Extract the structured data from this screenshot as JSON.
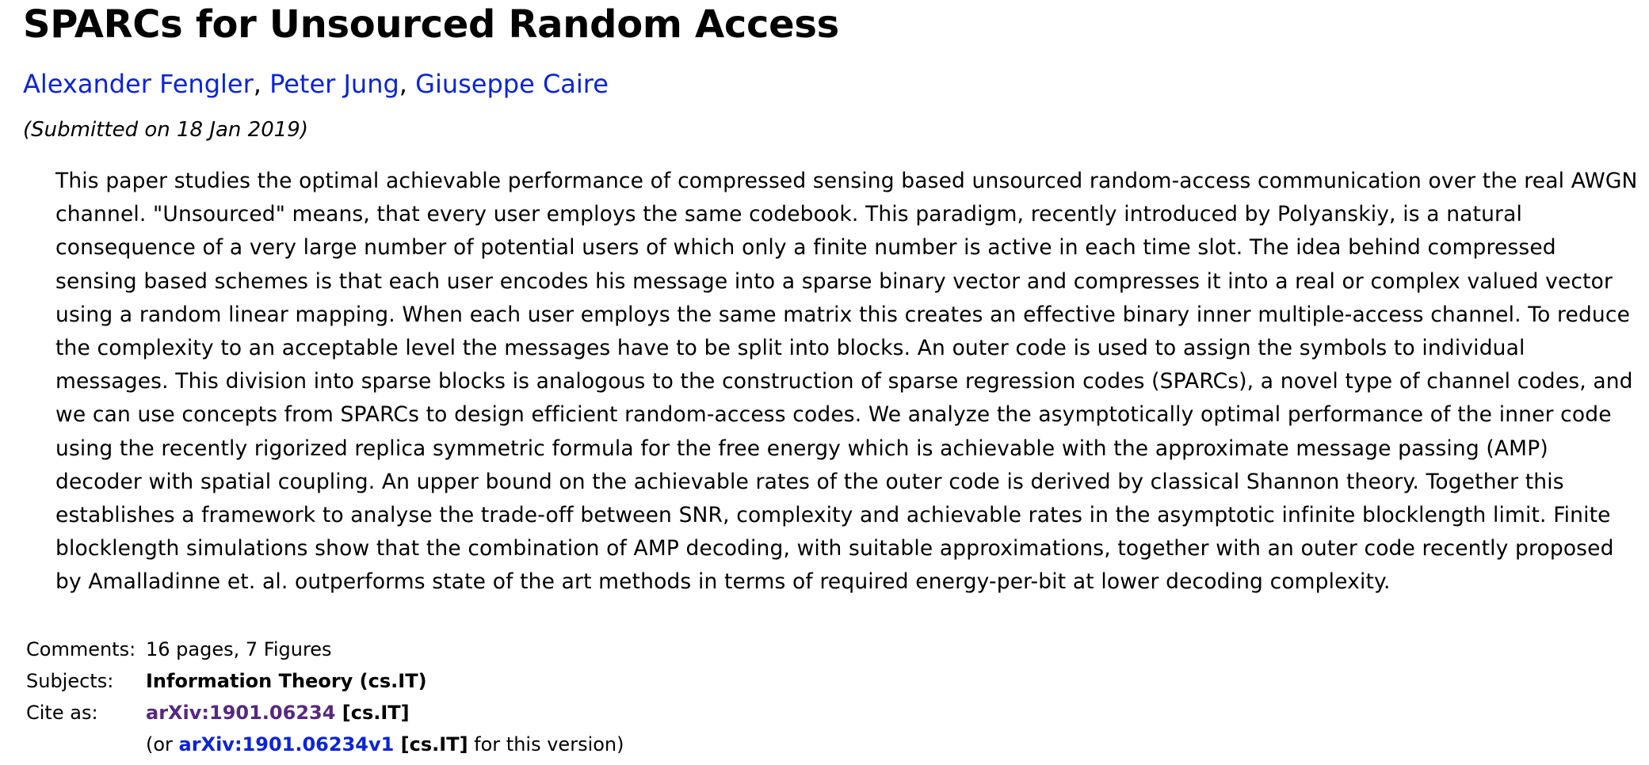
{
  "title": "SPARCs for Unsourced Random Access",
  "authors": [
    {
      "name": "Alexander Fengler"
    },
    {
      "name": "Peter Jung"
    },
    {
      "name": "Giuseppe Caire"
    }
  ],
  "author_separator": ", ",
  "dateline": "(Submitted on 18 Jan 2019)",
  "abstract": "This paper studies the optimal achievable performance of compressed sensing based unsourced random-access communication over the real AWGN channel. \"Unsourced\" means, that every user employs the same codebook. This paradigm, recently introduced by Polyanskiy, is a natural consequence of a very large number of potential users of which only a finite number is active in each time slot. The idea behind compressed sensing based schemes is that each user encodes his message into a sparse binary vector and compresses it into a real or complex valued vector using a random linear mapping. When each user employs the same matrix this creates an effective binary inner multiple-access channel. To reduce the complexity to an acceptable level the messages have to be split into blocks. An outer code is used to assign the symbols to individual messages. This division into sparse blocks is analogous to the construction of sparse regression codes (SPARCs), a novel type of channel codes, and we can use concepts from SPARCs to design efficient random-access codes. We analyze the asymptotically optimal performance of the inner code using the recently rigorized replica symmetric formula for the free energy which is achievable with the approximate message passing (AMP) decoder with spatial coupling. An upper bound on the achievable rates of the outer code is derived by classical Shannon theory. Together this establishes a framework to analyse the trade-off between SNR, complexity and achievable rates in the asymptotic infinite blocklength limit. Finite blocklength simulations show that the combination of AMP decoding, with suitable approximations, together with an outer code recently proposed by Amalladinne et. al. outperforms state of the art methods in terms of required energy-per-bit at lower decoding complexity.",
  "metadata": {
    "comments_label": "Comments:",
    "comments_value": "16 pages, 7 Figures",
    "subjects_label": "Subjects:",
    "subjects_value": "Information Theory (cs.IT)",
    "cite_label": "Cite as:",
    "cite_id": "arXiv:1901.06234",
    "cite_suffix": " [cs.IT]",
    "version_prefix": "(or ",
    "version_id": "arXiv:1901.06234v1",
    "version_bracket": " [cs.IT]",
    "version_suffix": " for this version)"
  },
  "colors": {
    "author_link": "#0b24d8",
    "cite_link": "#57287f",
    "version_link": "#0b24d8",
    "text": "#000000",
    "background": "#ffffff"
  }
}
